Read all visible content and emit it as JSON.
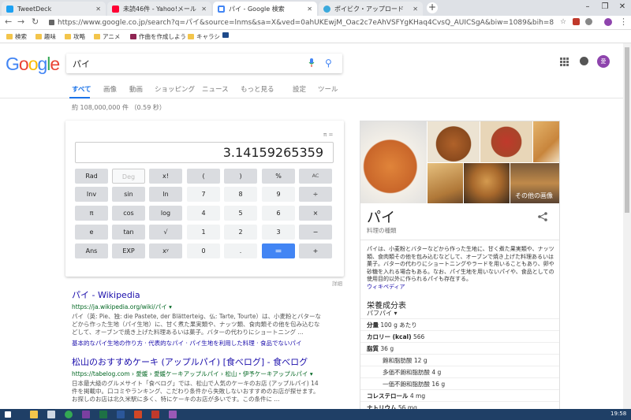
{
  "browser": {
    "tabs": [
      {
        "label": "TweetDeck",
        "color": "#1da1f2"
      },
      {
        "label": "未読46件 - Yahoo!メール",
        "color": "#ff0033"
      },
      {
        "label": "パイ - Google 検索",
        "color": "#4285f4"
      },
      {
        "label": "ポイビク・アップロード",
        "color": "#3ba9dc"
      }
    ],
    "url": "https://www.google.co.jp/search?q=パイ&source=lnms&sa=X&ved=0ahUKEwjM_Oac2c7eAhVSFYgKHaq4CvsQ_AUICSgA&biw=1089&bih=820&dpr=1.5",
    "bookmarks": [
      "検索",
      "趣味",
      "攻略",
      "アニメ",
      "作曲を作成しよう",
      "キャラシ"
    ]
  },
  "google": {
    "logo": "Google",
    "query": "パイ",
    "nav": [
      "すべて",
      "画像",
      "動画",
      "ショッピング",
      "ニュース",
      "もっと見る",
      "設定",
      "ツール"
    ],
    "stats": "約 108,000,000 件 （0.59 秒）",
    "avatar_letter": "愛"
  },
  "calculator": {
    "pi_label": "π =",
    "display": "3.14159265359",
    "keys": [
      [
        "Rad",
        "Deg",
        "x!",
        "(",
        ")",
        "%",
        "AC"
      ],
      [
        "Inv",
        "sin",
        "ln",
        "7",
        "8",
        "9",
        "÷"
      ],
      [
        "π",
        "cos",
        "log",
        "4",
        "5",
        "6",
        "×"
      ],
      [
        "e",
        "tan",
        "√",
        "1",
        "2",
        "3",
        "−"
      ],
      [
        "Ans",
        "EXP",
        "xʸ",
        "0",
        ".",
        "=",
        "+"
      ]
    ],
    "detail": "詳細"
  },
  "results": [
    {
      "title": "パイ - Wikipedia",
      "url": "https://ja.wikipedia.org/wiki/パイ ▾",
      "snippet": "パイ（英: Pie、独: die Pastete, der Blätterteig、仏: Tarte, Tourte）は、小麦粉とバターなどから作った生地（パイ生地）に、甘く煮た果実類や、ナッツ類、食肉類その他を包み込むなどして、オーブンで焼き上げた料理あるいは菓子。バターの代わりにショートニング ...",
      "links": "基本的なパイ生地の作り方 · 代表的なパイ · パイ生地を利用した料理 · 食品でないパイ"
    },
    {
      "title": "松山のおすすめケーキ (アップルパイ) [食べログ] - 食べログ",
      "url": "https://tabelog.com › 愛媛 › 愛媛ケーキアップルパイ › 松山・伊予ケーキアップルパイ ▾",
      "snippet": "日本最大級のグルメサイト「食べログ」では、松山で人気のケーキのお店 (アップルパイ) 14件を掲載中。口コミやランキング、こだわり条件から失敗しないおすすめのお店が探せます。お探しのお店は北久米駅に多く、特にケーキのお店が多いです。この条件に ...",
      "links": ""
    }
  ],
  "knowledge_panel": {
    "more_images": "その他の画像",
    "title": "パイ",
    "subtitle": "料理の種類",
    "description": "パイは、小麦粉とバターなどから作った生地に、甘く煮た果実類や、ナッツ類、食肉類その他を包み込むなどして、オーブンで焼き上げた料理あるいは菓子。バターの代わりにショートニングやラードを用いることもあり、卵や砂糖を入れる場合もある。なお、パイ生地を用いないパイや、食品としての使用目的以外に作られるパイも存在する。",
    "source": "ウィキペディア",
    "nutrition_title": "栄養成分表",
    "nutrition_select": "パフパイ ▾",
    "nutrition": [
      {
        "label": "分量",
        "value": "100 g あたり",
        "indent": false,
        "bold": true
      },
      {
        "label": "カロリー (kcal)",
        "value": "566",
        "indent": false,
        "bold": true
      },
      {
        "label": "脂質",
        "value": "36 g",
        "indent": false,
        "bold": true
      },
      {
        "label": "飽和脂肪酸",
        "value": "12 g",
        "indent": true,
        "bold": false
      },
      {
        "label": "多価不飽和脂肪酸",
        "value": "4 g",
        "indent": true,
        "bold": false
      },
      {
        "label": "一価不飽和脂肪酸",
        "value": "16 g",
        "indent": true,
        "bold": false
      },
      {
        "label": "コレステロール",
        "value": "4 mg",
        "indent": false,
        "bold": true
      },
      {
        "label": "ナトリウム",
        "value": "56 mg",
        "indent": false,
        "bold": true
      }
    ]
  },
  "taskbar": {
    "time": "19:58"
  }
}
